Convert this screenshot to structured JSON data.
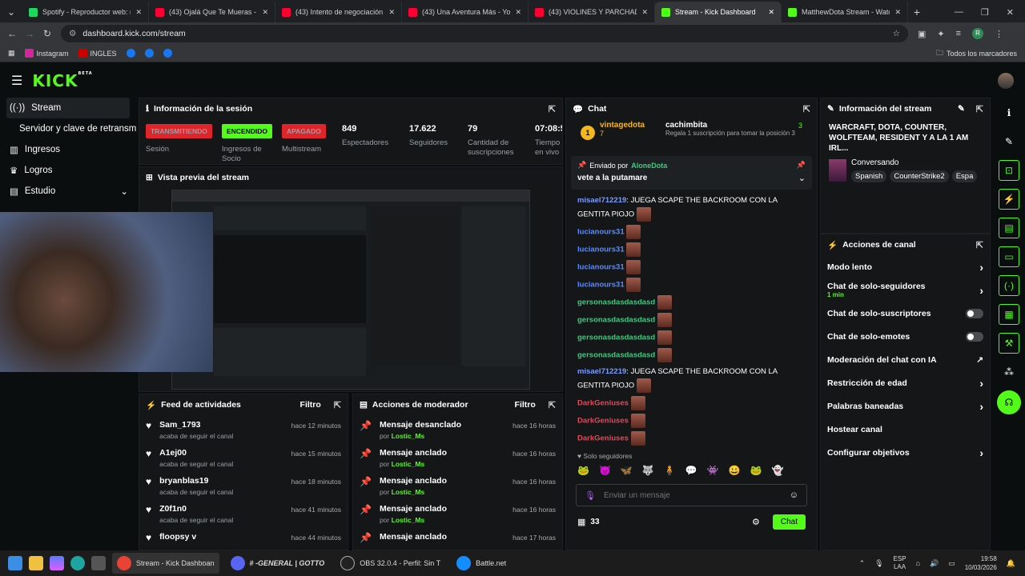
{
  "tabs": [
    {
      "title": "Spotify - Reproductor web: mú",
      "color": "#1ed760"
    },
    {
      "title": "(43) Ojalá Que Te Mueras - You",
      "color": "#ff0033"
    },
    {
      "title": "(43) Intento de negociación en",
      "color": "#ff0033"
    },
    {
      "title": "(43) Una Aventura Más - YouTu",
      "color": "#ff0033"
    },
    {
      "title": "(43) VIOLINES Y PARCHADAS",
      "color": "#ff0033"
    },
    {
      "title": "Stream - Kick Dashboard",
      "color": "#53fc18"
    },
    {
      "title": "MatthewDota Stream - Watch L",
      "color": "#53fc18"
    }
  ],
  "url": "dashboard.kick.com/stream",
  "bookmarks": [
    "Instagram",
    "INGLES",
    "Todos los marcadores"
  ],
  "logo": "KICK",
  "logo_badge": "BETA",
  "sidebar": {
    "items": [
      "Stream",
      "Servidor y clave de retransm",
      "Ingresos",
      "Logros",
      "Estudio"
    ]
  },
  "session": {
    "title": "Información de la sesión",
    "stats": [
      {
        "value": "TRANSMITIENDO",
        "label": "Sesión",
        "color": "#e0242c"
      },
      {
        "value": "ENCENDIDO",
        "label": "Ingresos de Socio",
        "color": "#53fc18"
      },
      {
        "value": "APAGADO",
        "label": "Multistream",
        "color": "#e0242c"
      },
      {
        "value": "849",
        "label": "Espectadores"
      },
      {
        "value": "17.622",
        "label": "Seguidores"
      },
      {
        "value": "79",
        "label": "Cantidad de suscripciones"
      },
      {
        "value": "07:08:5",
        "label": "Tiempo en vivo"
      }
    ]
  },
  "preview": {
    "title": "Vista previa del stream"
  },
  "feed": {
    "title": "Feed de actividades",
    "filter": "Filtro",
    "items": [
      {
        "name": "Sam_1793",
        "sub": "acaba de seguir el canal",
        "time": "hace 12 minutos"
      },
      {
        "name": "A1ej00",
        "sub": "acaba de seguir el canal",
        "time": "hace 15 minutos"
      },
      {
        "name": "bryanblas19",
        "sub": "acaba de seguir el canal",
        "time": "hace 18 minutos"
      },
      {
        "name": "Z0f1n0",
        "sub": "acaba de seguir el canal",
        "time": "hace 41 minutos"
      },
      {
        "name": "floopsy v",
        "sub": "",
        "time": "hace 44 minutos"
      }
    ]
  },
  "mod": {
    "title": "Acciones de moderador",
    "filter": "Filtro",
    "items": [
      {
        "name": "Mensaje desanclado",
        "by": "por",
        "user": "Lostic_Ms",
        "time": "hace 16 horas"
      },
      {
        "name": "Mensaje anclado",
        "by": "por",
        "user": "Lostic_Ms",
        "time": "hace 16 horas"
      },
      {
        "name": "Mensaje anclado",
        "by": "por",
        "user": "Lostic_Ms",
        "time": "hace 16 horas"
      },
      {
        "name": "Mensaje anclado",
        "by": "por",
        "user": "Lostic_Ms",
        "time": "hace 16 horas"
      },
      {
        "name": "Mensaje anclado",
        "by": "",
        "user": "",
        "time": "hace 17 horas"
      }
    ]
  },
  "chat": {
    "title": "Chat",
    "gift": {
      "rank": "1",
      "user": "vintagedota",
      "count": "7",
      "gifter": "cachimbita",
      "gifter_count": "3",
      "text": "Regala 1 suscripción para tomar la posición 3"
    },
    "pinned": {
      "label": "Enviado por",
      "user": "AloneDota",
      "text": "vete a la putamare"
    },
    "messages": [
      {
        "user": "misael712219",
        "color": "#7b9cff",
        "text": "JUEGA SCAPE THE BACKROOM CON LA GENTITA PIOJO"
      },
      {
        "user": "lucianours31",
        "color": "#5b8cff",
        "text": ""
      },
      {
        "user": "lucianours31",
        "color": "#5b8cff",
        "text": ""
      },
      {
        "user": "lucianours31",
        "color": "#5b8cff",
        "text": ""
      },
      {
        "user": "lucianours31",
        "color": "#5b8cff",
        "text": ""
      },
      {
        "user": "gersonasdasdasdasd",
        "color": "#3ccb7f",
        "text": ""
      },
      {
        "user": "gersonasdasdasdasd",
        "color": "#3ccb7f",
        "text": ""
      },
      {
        "user": "gersonasdasdasdasd",
        "color": "#3ccb7f",
        "text": ""
      },
      {
        "user": "gersonasdasdasdasd",
        "color": "#3ccb7f",
        "text": ""
      },
      {
        "user": "misael712219",
        "color": "#7b9cff",
        "text": "JUEGA SCAPE THE BACKROOM CON LA GENTITA PIOJO"
      },
      {
        "user": "DarkGeniuses",
        "color": "#e04a5a",
        "text": ""
      },
      {
        "user": "DarkGeniuses",
        "color": "#e04a5a",
        "text": ""
      },
      {
        "user": "DarkGeniuses",
        "color": "#e04a5a",
        "text": ""
      },
      {
        "user": "DarkGeniuses",
        "color": "#e04a5a",
        "text": ""
      }
    ],
    "mode": "Solo seguidores",
    "input_placeholder": "Enviar un mensaje",
    "viewers": "33",
    "send": "Chat"
  },
  "info": {
    "title": "Información del stream",
    "stream_title": "WARCRAFT, DOTA, COUNTER, WOLFTEAM, RESIDENT Y A LA 1 AM IRL...",
    "category": "Conversando",
    "tags": [
      "Spanish",
      "CounterStrike2",
      "Espa"
    ]
  },
  "actions": {
    "title": "Acciones de canal",
    "items": [
      {
        "label": "Modo lento",
        "control": "chevron"
      },
      {
        "label": "Chat de solo-seguidores",
        "sub": "1 min",
        "control": "chevron"
      },
      {
        "label": "Chat de solo-suscriptores",
        "control": "toggle"
      },
      {
        "label": "Chat de solo-emotes",
        "control": "toggle"
      },
      {
        "label": "Moderación del chat con IA",
        "control": "external"
      },
      {
        "label": "Restricción de edad",
        "control": "chevron"
      },
      {
        "label": "Palabras baneadas",
        "control": "chevron"
      },
      {
        "label": "Hostear canal",
        "control": "none"
      },
      {
        "label": "Configurar objetivos",
        "control": "chevron"
      }
    ]
  },
  "taskbar": {
    "items": [
      "Stream - Kick Dashboan",
      "# -GENERAL | GOTTO",
      "OBS 32.0.4 - Perfil: Sin T",
      "Battle.net"
    ],
    "lang": "ESP",
    "lang2": "LAA",
    "time": "19:58",
    "date": "10/03/2026"
  }
}
